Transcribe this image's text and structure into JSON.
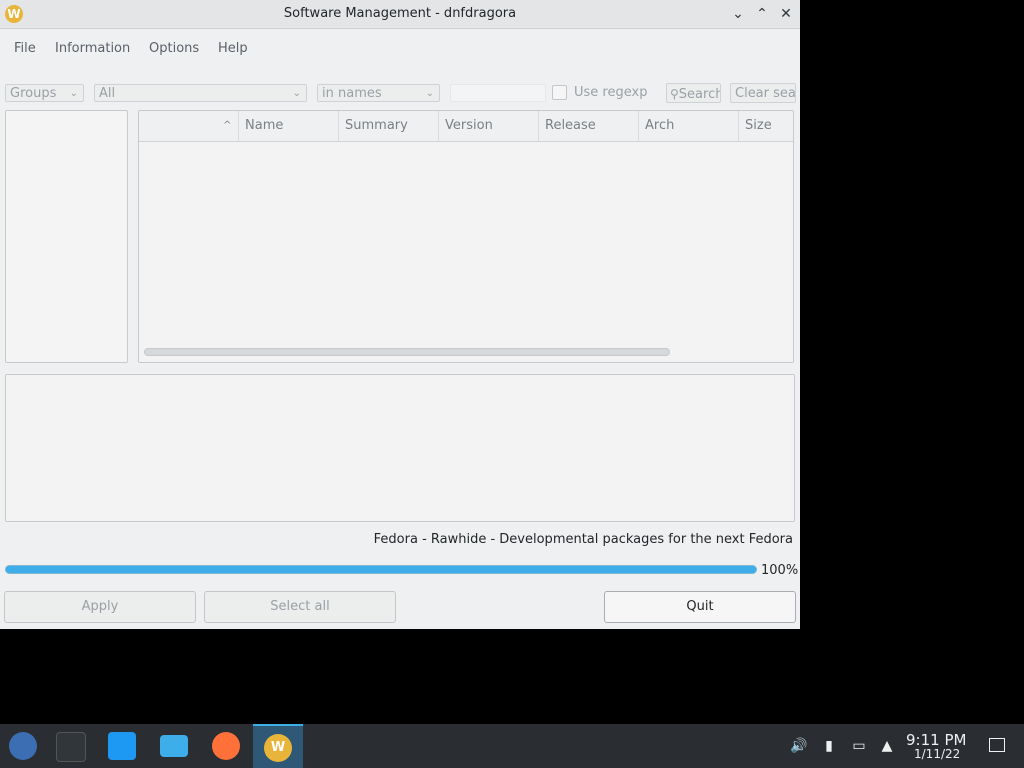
{
  "window": {
    "title": "Software Management - dnfdragora",
    "controls": {
      "minimize": "⌄",
      "maximize": "⌃",
      "close": "✕"
    }
  },
  "menu": [
    "File",
    "Information",
    "Options",
    "Help"
  ],
  "filters": {
    "view": "Groups",
    "filter": "All",
    "search_field": "in names",
    "search_value": "",
    "use_regexp_label": "Use regexp",
    "use_regexp_checked": false,
    "search_button": "Search",
    "clear_button": "Clear search"
  },
  "table": {
    "sort_icon": "^",
    "columns": [
      "Name",
      "Summary",
      "Version",
      "Release",
      "Arch",
      "Size"
    ]
  },
  "status": {
    "message": "Fedora - Rawhide - Developmental packages for the next Fedora",
    "progress_percent": 100,
    "progress_text": "100%"
  },
  "buttons": {
    "apply": "Apply",
    "select_all": "Select all",
    "quit": "Quit"
  },
  "taskbar": {
    "apps": [
      "fedora-launcher-icon",
      "system-settings-icon",
      "software-center-icon",
      "file-manager-icon",
      "firefox-icon",
      "dnfdragora-icon"
    ],
    "clock_time": "9:11 PM",
    "clock_date": "1/11/22"
  },
  "colors": {
    "accent": "#3daee9",
    "taskbar": "#2a2e32",
    "window_bg": "#eff0f1"
  }
}
